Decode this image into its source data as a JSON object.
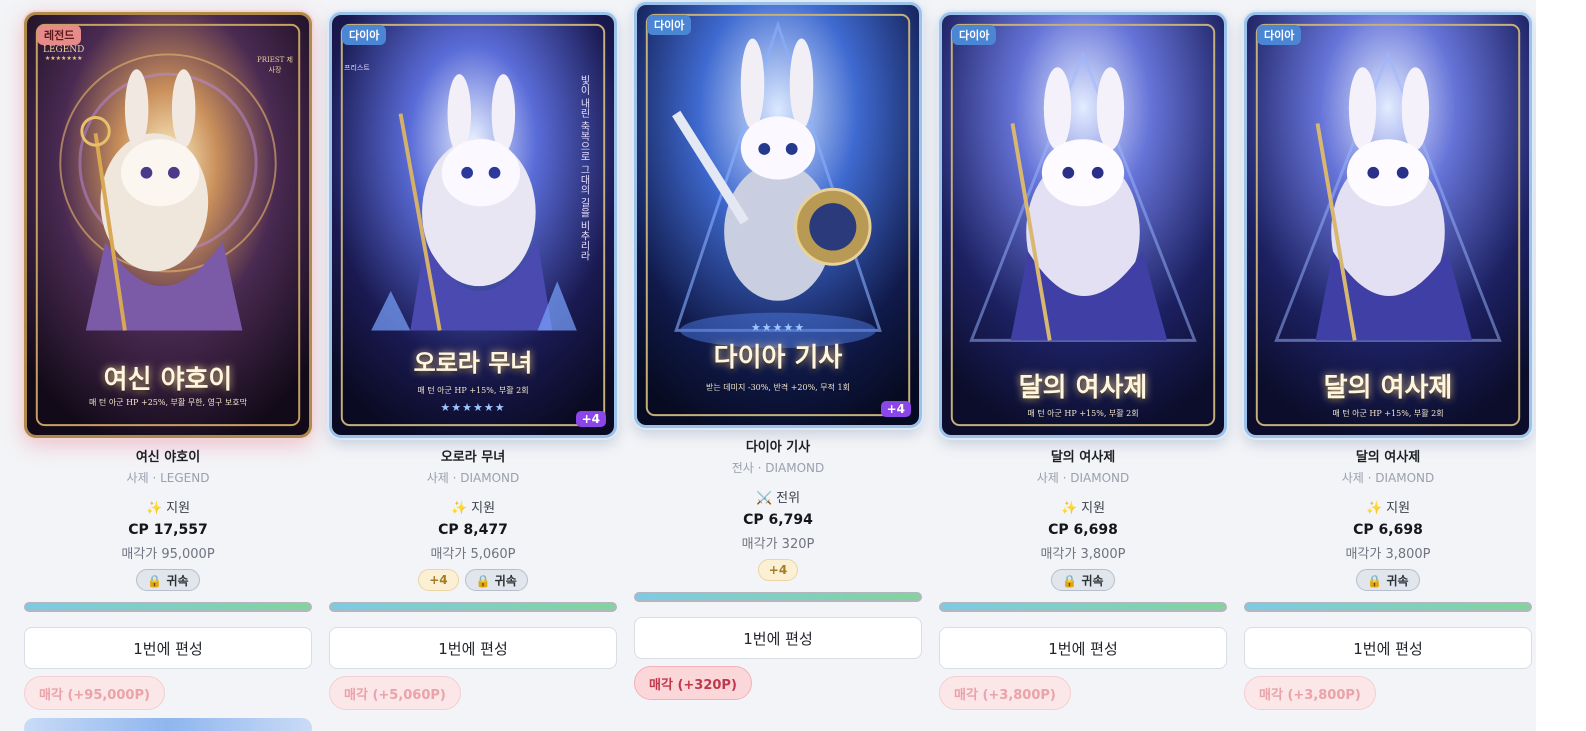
{
  "cards": [
    {
      "grade_badge": "레전드",
      "art_title": "여신 야호이",
      "art_subtitle": "매 턴 아군 HP +25%, 부활 무한, 영구 보호막",
      "art_legend_mark": "LEGEND",
      "art_stars": "★★★★★★★",
      "art_class_mark": "PRIEST 제사장",
      "name": "여신 야호이",
      "class_line": "사제 · LEGEND",
      "role_icon": "✨",
      "role": "지원",
      "cp": "CP 17,557",
      "sell_price": "매각가 95,000P",
      "tags": {
        "enhance": "",
        "bound": "🔒 귀속"
      },
      "enh_badge": "",
      "bar_level": 1.0,
      "form_button": "1번에 편성",
      "sell_button": "매각 (+95,000P)"
    },
    {
      "grade_badge": "다이아",
      "art_title": "오로라 무녀",
      "art_subtitle": "매 턴 아군 HP +15%, 부활 2회",
      "art_vertical": "빛이 내린 축복으로 그대의 길을 비추리라",
      "art_logo": "프리스트",
      "art_stars": "★★★★★★",
      "name": "오로라 무녀",
      "class_line": "사제 · DIAMOND",
      "role_icon": "✨",
      "role": "지원",
      "cp": "CP 8,477",
      "sell_price": "매각가 5,060P",
      "tags": {
        "enhance": "+4",
        "bound": "🔒 귀속"
      },
      "enh_badge": "+4",
      "bar_level": 1.0,
      "form_button": "1번에 편성",
      "sell_button": "매각 (+5,060P)"
    },
    {
      "grade_badge": "다이아",
      "art_title": "다이아 기사",
      "art_subtitle": "받는 데미지 -30%, 반격 +20%, 무적 1회",
      "art_stars": "★★★★★",
      "name": "다이아 기사",
      "class_line": "전사 · DIAMOND",
      "role_icon": "⚔️",
      "role": "전위",
      "cp": "CP 6,794",
      "sell_price": "매각가 320P",
      "tags": {
        "enhance": "+4",
        "bound": ""
      },
      "enh_badge": "+4",
      "bar_level": 1.0,
      "form_button": "1번에 편성",
      "sell_button": "매각 (+320P)"
    },
    {
      "grade_badge": "다이아",
      "art_title": "달의 여사제",
      "art_subtitle": "매 턴 아군 HP +15%, 부활 2회",
      "name": "달의 여사제",
      "class_line": "사제 · DIAMOND",
      "role_icon": "✨",
      "role": "지원",
      "cp": "CP 6,698",
      "sell_price": "매각가 3,800P",
      "tags": {
        "enhance": "",
        "bound": "🔒 귀속"
      },
      "enh_badge": "",
      "bar_level": 1.0,
      "form_button": "1번에 편성",
      "sell_button": "매각 (+3,800P)"
    },
    {
      "grade_badge": "다이아",
      "art_title": "달의 여사제",
      "art_subtitle": "매 턴 아군 HP +15%, 부활 2회",
      "name": "달의 여사제",
      "class_line": "사제 · DIAMOND",
      "role_icon": "✨",
      "role": "지원",
      "cp": "CP 6,698",
      "sell_price": "매각가 3,800P",
      "tags": {
        "enhance": "",
        "bound": "🔒 귀속"
      },
      "enh_badge": "",
      "bar_level": 1.0,
      "form_button": "1번에 편성",
      "sell_button": "매각 (+3,800P)"
    }
  ],
  "colors": {
    "legend_border": "#b08a4a",
    "diamond_border": "#9cc2ea",
    "diamond_badge": "#4a86d4",
    "legend_badge": "#e78a8a",
    "enhance_purple": "#8a46e6",
    "sell_text": "#c0394a"
  }
}
